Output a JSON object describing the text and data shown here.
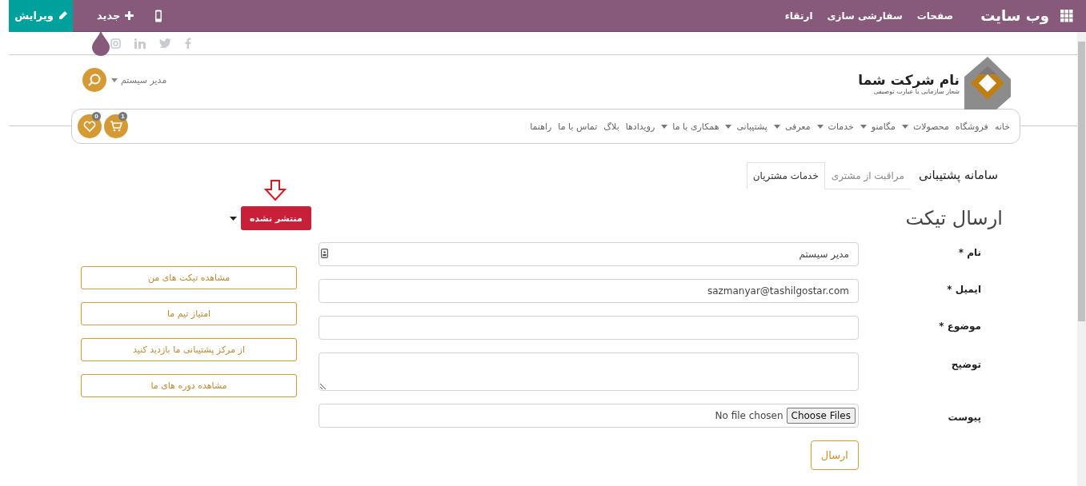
{
  "topbar": {
    "app_title": "وب سایت",
    "menus": [
      "صفحات",
      "سفارشی سازی",
      "ارتقاء"
    ],
    "new_button": "جدید",
    "edit_button": "ویرایش"
  },
  "header": {
    "company_name": "نام شرکت شما",
    "tagline": "شعار سازمانی یا عبارت توصیفی",
    "user_menu": "مدیر سیستم",
    "cart_count": "1",
    "wishlist_count": "0"
  },
  "nav": [
    {
      "label": "خانه",
      "dropdown": false
    },
    {
      "label": "فروشگاه",
      "dropdown": false
    },
    {
      "label": "محصولات",
      "dropdown": true
    },
    {
      "label": "مگامنو",
      "dropdown": true
    },
    {
      "label": "خدمات",
      "dropdown": true
    },
    {
      "label": "معرفی",
      "dropdown": true
    },
    {
      "label": "پشتیبانی",
      "dropdown": true
    },
    {
      "label": "همکاری با ما",
      "dropdown": true
    },
    {
      "label": "رویدادها",
      "dropdown": false
    },
    {
      "label": "بلاگ",
      "dropdown": false
    },
    {
      "label": "تماس با ما",
      "dropdown": false
    },
    {
      "label": "راهنما",
      "dropdown": false
    }
  ],
  "breadcrumb": {
    "title": "سامانه پشتیبانی",
    "tabs": [
      {
        "label": "مراقبت از مشتری",
        "selected": false
      },
      {
        "label": "خدمات مشتریان",
        "selected": true
      }
    ]
  },
  "heading": "ارسال تیکت",
  "publish_button": {
    "label": "منتشر نشده",
    "published": false
  },
  "form": {
    "fields": [
      {
        "label": "نام *",
        "kind": "text",
        "value": "مدیر سیستم"
      },
      {
        "label": "ایمیل *",
        "kind": "text",
        "value": "sazmanyar@tashilgostar.com"
      },
      {
        "label": "موضوع *",
        "kind": "text"
      },
      {
        "label": "توضیح",
        "kind": "textarea"
      },
      {
        "label": "پیوست",
        "kind": "file",
        "button": "Choose Files",
        "value": "No file chosen"
      }
    ],
    "submit": "ارسال"
  },
  "side_links": [
    "مشاهده تیکت های من",
    "امتیاز تیم ما",
    "از مرکز پشتیبانی ما بازدید کنید",
    "مشاهده دوره های ما"
  ]
}
